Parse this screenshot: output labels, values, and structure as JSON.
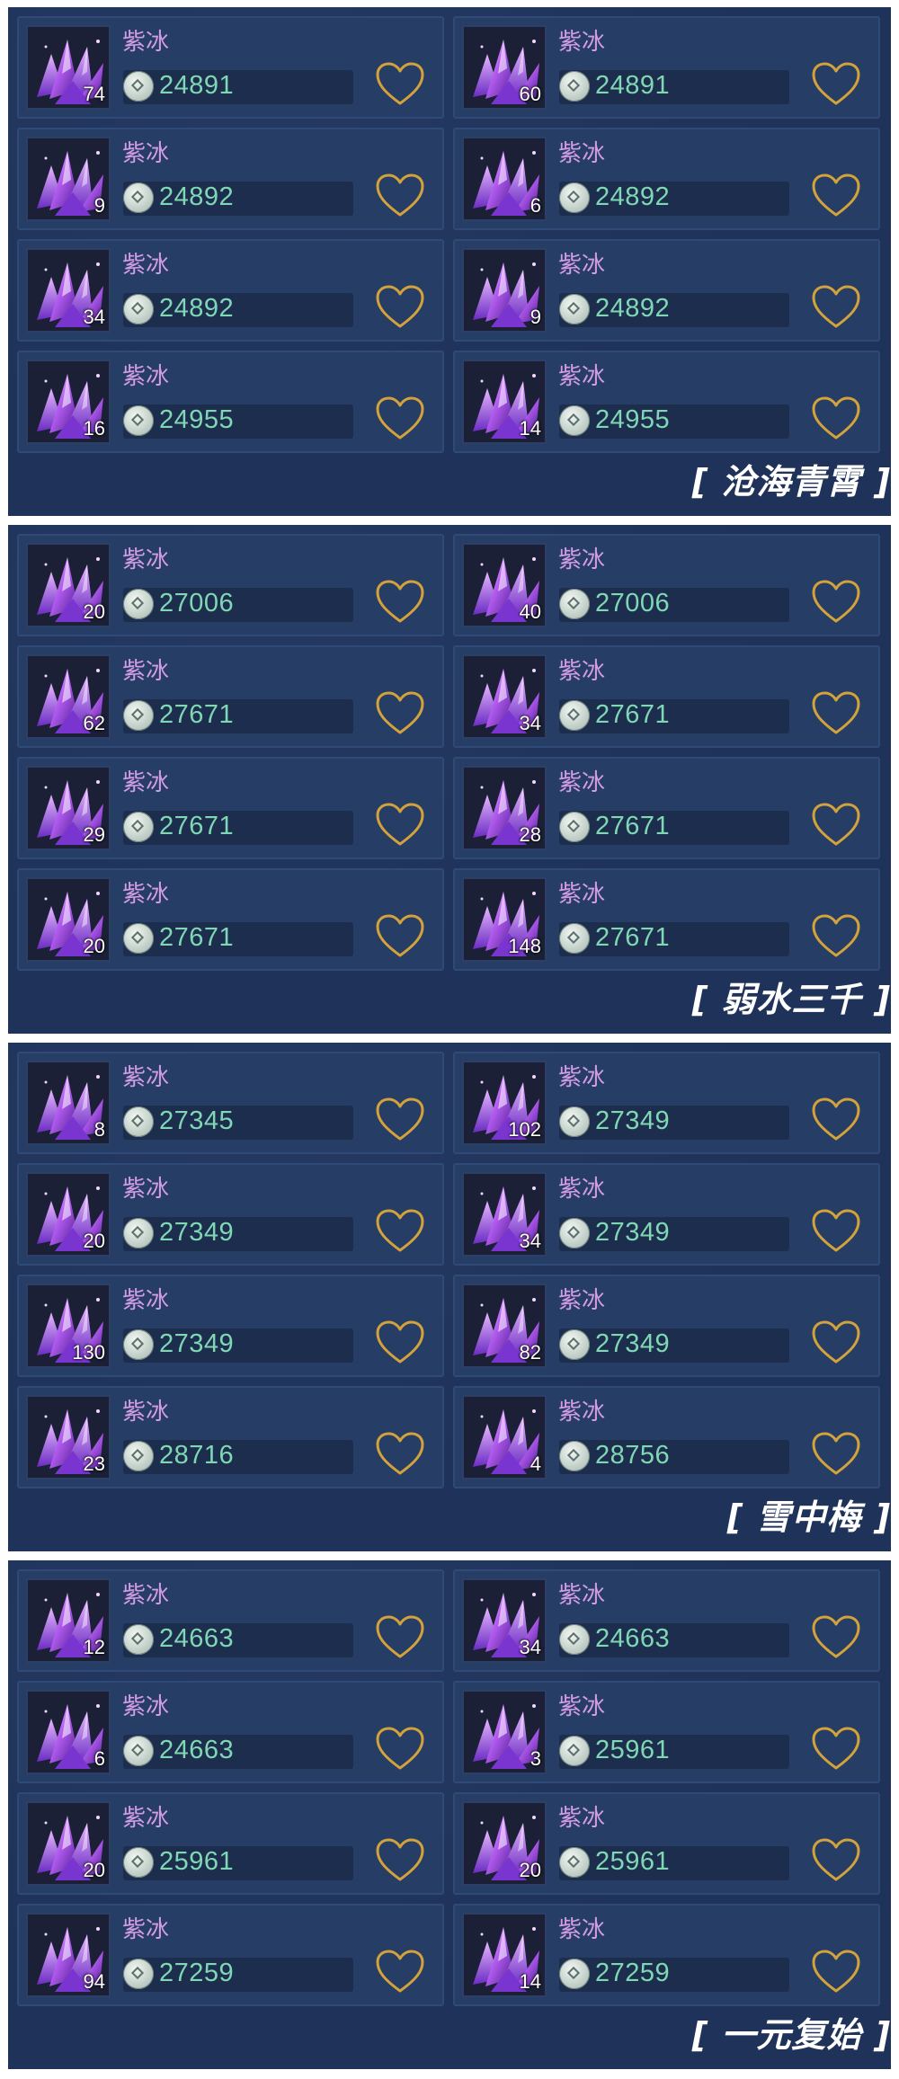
{
  "item_name": "紫冰",
  "colors": {
    "panel": "#1f3259",
    "name": "#d59ce6",
    "price": "#7fd7b3",
    "heart": "#d4a23a"
  },
  "icons": {
    "item": "purple-crystal-icon",
    "currency": "silver-coin-icon",
    "favorite": "heart-outline-icon"
  },
  "panels": [
    {
      "label": "[ 沧海青霄 ]",
      "items": [
        {
          "qty": "74",
          "price": "24891"
        },
        {
          "qty": "60",
          "price": "24891"
        },
        {
          "qty": "9",
          "price": "24892"
        },
        {
          "qty": "6",
          "price": "24892"
        },
        {
          "qty": "34",
          "price": "24892"
        },
        {
          "qty": "9",
          "price": "24892"
        },
        {
          "qty": "16",
          "price": "24955"
        },
        {
          "qty": "14",
          "price": "24955"
        }
      ]
    },
    {
      "label": "[ 弱水三千 ]",
      "items": [
        {
          "qty": "20",
          "price": "27006"
        },
        {
          "qty": "40",
          "price": "27006"
        },
        {
          "qty": "62",
          "price": "27671"
        },
        {
          "qty": "34",
          "price": "27671"
        },
        {
          "qty": "29",
          "price": "27671"
        },
        {
          "qty": "28",
          "price": "27671"
        },
        {
          "qty": "20",
          "price": "27671"
        },
        {
          "qty": "148",
          "price": "27671"
        }
      ]
    },
    {
      "label": "[ 雪中梅 ]",
      "items": [
        {
          "qty": "8",
          "price": "27345"
        },
        {
          "qty": "102",
          "price": "27349"
        },
        {
          "qty": "20",
          "price": "27349"
        },
        {
          "qty": "34",
          "price": "27349"
        },
        {
          "qty": "130",
          "price": "27349"
        },
        {
          "qty": "82",
          "price": "27349"
        },
        {
          "qty": "23",
          "price": "28716"
        },
        {
          "qty": "4",
          "price": "28756"
        }
      ]
    },
    {
      "label": "[ 一元复始 ]",
      "items": [
        {
          "qty": "12",
          "price": "24663"
        },
        {
          "qty": "34",
          "price": "24663"
        },
        {
          "qty": "6",
          "price": "24663"
        },
        {
          "qty": "3",
          "price": "25961"
        },
        {
          "qty": "20",
          "price": "25961"
        },
        {
          "qty": "20",
          "price": "25961"
        },
        {
          "qty": "94",
          "price": "27259"
        },
        {
          "qty": "14",
          "price": "27259"
        }
      ]
    }
  ]
}
